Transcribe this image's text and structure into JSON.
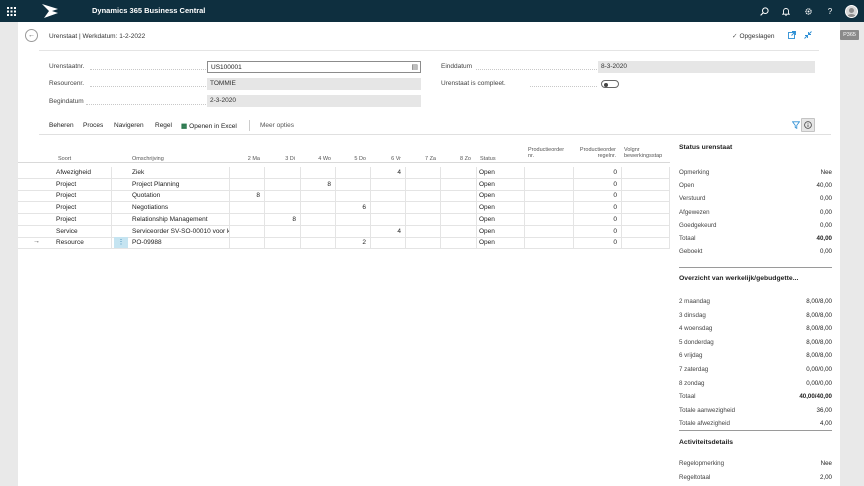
{
  "topbar": {
    "app_title": "Dynamics 365 Business Central",
    "icons": [
      "waffle-icon",
      "search-icon",
      "bell-icon",
      "gear-icon",
      "help-icon",
      "avatar"
    ]
  },
  "badge": "P365",
  "header": {
    "title": "Urenstaat | Werkdatum: 1-2-2022",
    "saved_label": "Opgeslagen"
  },
  "fields": {
    "urenstaatnr_label": "Urenstaatnr.",
    "urenstaatnr_value": "US100001",
    "resourcenr_label": "Resourcenr.",
    "resourcenr_value": "TOMMIE",
    "begindatum_label": "Begindatum",
    "begindatum_value": "2-3-2020",
    "einddatum_label": "Einddatum",
    "einddatum_value": "8-3-2020",
    "compleet_label": "Urenstaat is compleet.",
    "compleet_value": false
  },
  "actions": {
    "beheren": "Beheren",
    "proces": "Proces",
    "navigeren": "Navigeren",
    "regel": "Regel",
    "openen_excel": "Openen in Excel",
    "meer_opties": "Meer opties"
  },
  "grid": {
    "headers": {
      "soort": "Soort",
      "omschrijving": "Omschrijving",
      "d1": "2 Ma",
      "d2": "3 Di",
      "d3": "4 Wo",
      "d4": "5 Do",
      "d5": "6 Vr",
      "d6": "7 Za",
      "d7": "8 Zo",
      "status": "Status",
      "prodorder_nr_1": "Productieorder",
      "prodorder_nr_2": "nr.",
      "prodorder_regel_1": "Productieorder",
      "prodorder_regel_2": "regelnr.",
      "volgnr_1": "Volgnr",
      "volgnr_2": "bewerkingsstap"
    },
    "rows": [
      {
        "soort": "Afwezigheid",
        "omschrijving": "Ziek",
        "d1": "",
        "d2": "",
        "d3": "",
        "d4": "",
        "d5": "4",
        "d6": "",
        "d7": "",
        "status": "Open",
        "prodorder_nr": "",
        "prodorder_regel": "0",
        "volgnr": ""
      },
      {
        "soort": "Project",
        "omschrijving": "Project Planning",
        "d1": "",
        "d2": "",
        "d3": "8",
        "d4": "",
        "d5": "",
        "d6": "",
        "d7": "",
        "status": "Open",
        "prodorder_nr": "",
        "prodorder_regel": "0",
        "volgnr": ""
      },
      {
        "soort": "Project",
        "omschrijving": "Quotation",
        "d1": "8",
        "d2": "",
        "d3": "",
        "d4": "",
        "d5": "",
        "d6": "",
        "d7": "",
        "status": "Open",
        "prodorder_nr": "",
        "prodorder_regel": "0",
        "volgnr": ""
      },
      {
        "soort": "Project",
        "omschrijving": "Negotiations",
        "d1": "",
        "d2": "",
        "d3": "",
        "d4": "6",
        "d5": "",
        "d6": "",
        "d7": "",
        "status": "Open",
        "prodorder_nr": "",
        "prodorder_regel": "0",
        "volgnr": ""
      },
      {
        "soort": "Project",
        "omschrijving": "Relationship Management",
        "d1": "",
        "d2": "8",
        "d3": "",
        "d4": "",
        "d5": "",
        "d6": "",
        "d7": "",
        "status": "Open",
        "prodorder_nr": "",
        "prodorder_regel": "0",
        "volgnr": ""
      },
      {
        "soort": "Service",
        "omschrijving": "Serviceorder SV-SO-00010 voor k...",
        "d1": "",
        "d2": "",
        "d3": "",
        "d4": "",
        "d5": "4",
        "d6": "",
        "d7": "",
        "status": "Open",
        "prodorder_nr": "",
        "prodorder_regel": "0",
        "volgnr": ""
      },
      {
        "soort": "Resource",
        "omschrijving": "PO-09988",
        "d1": "",
        "d2": "",
        "d3": "",
        "d4": "2",
        "d5": "",
        "d6": "",
        "d7": "",
        "status": "Open",
        "prodorder_nr": "",
        "prodorder_regel": "0",
        "volgnr": ""
      }
    ]
  },
  "factbox": {
    "status_title": "Status urenstaat",
    "status_rows": [
      {
        "label": "Opmerking",
        "value": "Nee"
      },
      {
        "label": "Open",
        "value": "40,00"
      },
      {
        "label": "Verstuurd",
        "value": "0,00"
      },
      {
        "label": "Afgewezen",
        "value": "0,00"
      },
      {
        "label": "Goedgekeurd",
        "value": "0,00"
      },
      {
        "label": "Totaal",
        "value": "40,00"
      },
      {
        "label": "Geboekt",
        "value": "0,00"
      }
    ],
    "overview_title": "Overzicht van werkelijk/gebudgette...",
    "overview_rows": [
      {
        "label": "2 maandag",
        "value": "8,00/8,00"
      },
      {
        "label": "3 dinsdag",
        "value": "8,00/8,00"
      },
      {
        "label": "4 woensdag",
        "value": "8,00/8,00"
      },
      {
        "label": "5 donderdag",
        "value": "8,00/8,00"
      },
      {
        "label": "6 vrijdag",
        "value": "8,00/8,00"
      },
      {
        "label": "7 zaterdag",
        "value": "0,00/0,00"
      },
      {
        "label": "8 zondag",
        "value": "0,00/0,00"
      },
      {
        "label": "Totaal",
        "value": "40,00/40,00"
      },
      {
        "label": "Totale aanwezigheid",
        "value": "36,00"
      },
      {
        "label": "Totale afwezigheid",
        "value": "4,00"
      }
    ],
    "activity_title": "Activiteitsdetails",
    "activity_rows": [
      {
        "label": "Regelopmerking",
        "value": "Nee"
      },
      {
        "label": "Regeltotaal",
        "value": "2,00"
      }
    ]
  }
}
